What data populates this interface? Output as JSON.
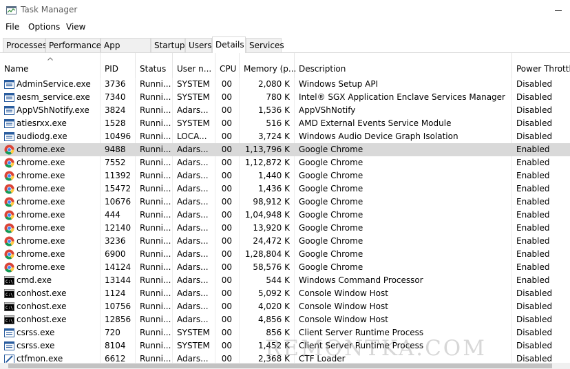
{
  "window": {
    "title": "Task Manager"
  },
  "menu": [
    "File",
    "Options",
    "View"
  ],
  "tabs": [
    {
      "label": "Processes",
      "active": false
    },
    {
      "label": "Performance",
      "active": false
    },
    {
      "label": "App history",
      "active": false
    },
    {
      "label": "Startup",
      "active": false
    },
    {
      "label": "Users",
      "active": false
    },
    {
      "label": "Details",
      "active": true
    },
    {
      "label": "Services",
      "active": false
    }
  ],
  "columns": [
    "Name",
    "PID",
    "Status",
    "User n...",
    "CPU",
    "Memory (p...",
    "Description",
    "Power Throttlin"
  ],
  "sort": {
    "column": "Name",
    "direction": "ascending",
    "icon": "sort-up-chevron-icon"
  },
  "rows": [
    {
      "icon": "window-app-icon",
      "name": "AdminService.exe",
      "pid": "3736",
      "status": "Runni...",
      "user": "SYSTEM",
      "cpu": "00",
      "memory": "2,080 K",
      "description": "Windows Setup API",
      "power": "Disabled"
    },
    {
      "icon": "window-app-icon",
      "name": "aesm_service.exe",
      "pid": "7340",
      "status": "Runni...",
      "user": "SYSTEM",
      "cpu": "00",
      "memory": "780 K",
      "description": "Intel® SGX Application Enclave Services Manager",
      "power": "Disabled"
    },
    {
      "icon": "window-app-icon",
      "name": "AppVShNotify.exe",
      "pid": "3824",
      "status": "Runni...",
      "user": "Adars...",
      "cpu": "00",
      "memory": "1,536 K",
      "description": "AppVShNotify",
      "power": "Disabled"
    },
    {
      "icon": "window-app-icon",
      "name": "atiesrxx.exe",
      "pid": "1528",
      "status": "Runni...",
      "user": "SYSTEM",
      "cpu": "00",
      "memory": "516 K",
      "description": "AMD External Events Service Module",
      "power": "Disabled"
    },
    {
      "icon": "window-app-icon",
      "name": "audiodg.exe",
      "pid": "10496",
      "status": "Runni...",
      "user": "LOCA...",
      "cpu": "00",
      "memory": "3,724 K",
      "description": "Windows Audio Device Graph Isolation",
      "power": "Disabled"
    },
    {
      "icon": "chrome-icon",
      "name": "chrome.exe",
      "pid": "9488",
      "status": "Runni...",
      "user": "Adars...",
      "cpu": "00",
      "memory": "1,13,796 K",
      "description": "Google Chrome",
      "power": "Enabled",
      "selected": true
    },
    {
      "icon": "chrome-icon",
      "name": "chrome.exe",
      "pid": "7552",
      "status": "Runni...",
      "user": "Adars...",
      "cpu": "00",
      "memory": "1,12,872 K",
      "description": "Google Chrome",
      "power": "Enabled"
    },
    {
      "icon": "chrome-icon",
      "name": "chrome.exe",
      "pid": "11392",
      "status": "Runni...",
      "user": "Adars...",
      "cpu": "00",
      "memory": "1,440 K",
      "description": "Google Chrome",
      "power": "Enabled"
    },
    {
      "icon": "chrome-icon",
      "name": "chrome.exe",
      "pid": "15472",
      "status": "Runni...",
      "user": "Adars...",
      "cpu": "00",
      "memory": "1,436 K",
      "description": "Google Chrome",
      "power": "Enabled"
    },
    {
      "icon": "chrome-icon",
      "name": "chrome.exe",
      "pid": "10676",
      "status": "Runni...",
      "user": "Adars...",
      "cpu": "00",
      "memory": "98,912 K",
      "description": "Google Chrome",
      "power": "Enabled"
    },
    {
      "icon": "chrome-icon",
      "name": "chrome.exe",
      "pid": "444",
      "status": "Runni...",
      "user": "Adars...",
      "cpu": "00",
      "memory": "1,04,948 K",
      "description": "Google Chrome",
      "power": "Enabled"
    },
    {
      "icon": "chrome-icon",
      "name": "chrome.exe",
      "pid": "12140",
      "status": "Runni...",
      "user": "Adars...",
      "cpu": "00",
      "memory": "13,920 K",
      "description": "Google Chrome",
      "power": "Enabled"
    },
    {
      "icon": "chrome-icon",
      "name": "chrome.exe",
      "pid": "3236",
      "status": "Runni...",
      "user": "Adars...",
      "cpu": "00",
      "memory": "24,472 K",
      "description": "Google Chrome",
      "power": "Enabled"
    },
    {
      "icon": "chrome-icon",
      "name": "chrome.exe",
      "pid": "6900",
      "status": "Runni...",
      "user": "Adars...",
      "cpu": "00",
      "memory": "1,28,804 K",
      "description": "Google Chrome",
      "power": "Enabled"
    },
    {
      "icon": "chrome-icon",
      "name": "chrome.exe",
      "pid": "14124",
      "status": "Runni...",
      "user": "Adars...",
      "cpu": "00",
      "memory": "58,576 K",
      "description": "Google Chrome",
      "power": "Enabled"
    },
    {
      "icon": "console-icon",
      "name": "cmd.exe",
      "pid": "13144",
      "status": "Runni...",
      "user": "Adars...",
      "cpu": "00",
      "memory": "544 K",
      "description": "Windows Command Processor",
      "power": "Enabled"
    },
    {
      "icon": "console-icon",
      "name": "conhost.exe",
      "pid": "1124",
      "status": "Runni...",
      "user": "Adars...",
      "cpu": "00",
      "memory": "5,092 K",
      "description": "Console Window Host",
      "power": "Disabled"
    },
    {
      "icon": "console-icon",
      "name": "conhost.exe",
      "pid": "10756",
      "status": "Runni...",
      "user": "Adars...",
      "cpu": "00",
      "memory": "4,020 K",
      "description": "Console Window Host",
      "power": "Disabled"
    },
    {
      "icon": "console-icon",
      "name": "conhost.exe",
      "pid": "12856",
      "status": "Runni...",
      "user": "Adars...",
      "cpu": "00",
      "memory": "4,856 K",
      "description": "Console Window Host",
      "power": "Disabled"
    },
    {
      "icon": "window-app-icon",
      "name": "csrss.exe",
      "pid": "720",
      "status": "Runni...",
      "user": "SYSTEM",
      "cpu": "00",
      "memory": "856 K",
      "description": "Client Server Runtime Process",
      "power": "Disabled"
    },
    {
      "icon": "window-app-icon",
      "name": "csrss.exe",
      "pid": "8104",
      "status": "Runni...",
      "user": "SYSTEM",
      "cpu": "00",
      "memory": "1,452 K",
      "description": "Client Server Runtime Process",
      "power": "Disabled"
    },
    {
      "icon": "pen-icon",
      "name": "ctfmon.exe",
      "pid": "6612",
      "status": "Runni...",
      "user": "Adars...",
      "cpu": "00",
      "memory": "2,368 K",
      "description": "CTF Loader",
      "power": "Disabled"
    }
  ],
  "watermark": "REMONTKA.COM",
  "colors": {
    "selected_row": "#d9d9d9",
    "tab_bg": "#f0f0f0",
    "border": "#d9d9d9"
  }
}
